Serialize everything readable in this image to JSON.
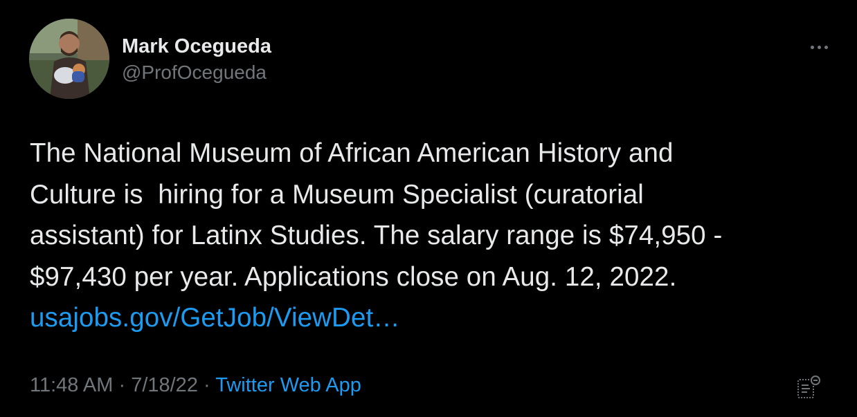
{
  "tweet": {
    "author": {
      "display_name": "Mark Ocegueda",
      "handle": "@ProfOcegueda"
    },
    "text_line1": "The National Museum of African American History and",
    "text_line2": "Culture is  hiring for a Museum Specialist (curatorial",
    "text_line3": "assistant) for Latinx Studies. The salary range is $74,950 -",
    "text_line4": "$97,430 per year. Applications close on Aug. 12, 2022.",
    "link_text": "usajobs.gov/GetJob/ViewDet…",
    "time": "11:48 AM",
    "separator": "·",
    "date": "7/18/22",
    "source": "Twitter Web App"
  },
  "colors": {
    "background": "#000000",
    "text": "#e7e9ea",
    "secondary": "#71767b",
    "link": "#1d9bf0"
  },
  "icons": {
    "more": "more-horizontal-icon",
    "analytics": "tweet-analytics-icon"
  }
}
